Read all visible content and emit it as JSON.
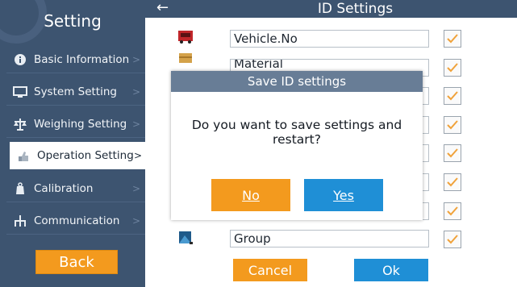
{
  "sidebar": {
    "title": "Setting",
    "items": [
      {
        "label": "Basic Information",
        "icon": "info-icon"
      },
      {
        "label": "System Setting",
        "icon": "monitor-icon"
      },
      {
        "label": "Weighing Setting",
        "icon": "scale-icon"
      },
      {
        "label": "Operation Setting",
        "icon": "hand-icon",
        "active": true
      },
      {
        "label": "Calibration",
        "icon": "weight-icon"
      },
      {
        "label": "Communication",
        "icon": "network-icon"
      }
    ],
    "chevron": ">",
    "back_label": "Back"
  },
  "header": {
    "back_arrow": "←",
    "title": "ID Settings"
  },
  "id_rows": [
    {
      "value": "Vehicle.No",
      "checked": true,
      "icon": "truck-icon"
    },
    {
      "value": "Material",
      "checked": true,
      "icon": "box-icon"
    },
    {
      "value": "",
      "checked": true,
      "icon": ""
    },
    {
      "value": "",
      "checked": true,
      "icon": ""
    },
    {
      "value": "",
      "checked": true,
      "icon": ""
    },
    {
      "value": "",
      "checked": true,
      "icon": ""
    },
    {
      "value": "",
      "checked": true,
      "icon": ""
    },
    {
      "value": "Group",
      "checked": true,
      "icon": "group-icon"
    }
  ],
  "footer": {
    "cancel_label": "Cancel",
    "ok_label": "Ok"
  },
  "dialog": {
    "title": "Save ID settings",
    "message": "Do you want to save settings and restart?",
    "no_label": "No",
    "yes_label": "Yes"
  },
  "colors": {
    "sidebar_bg": "#3d5470",
    "accent_orange": "#f39a1e",
    "accent_blue": "#1f8fd6",
    "dialog_header": "#687d96"
  }
}
